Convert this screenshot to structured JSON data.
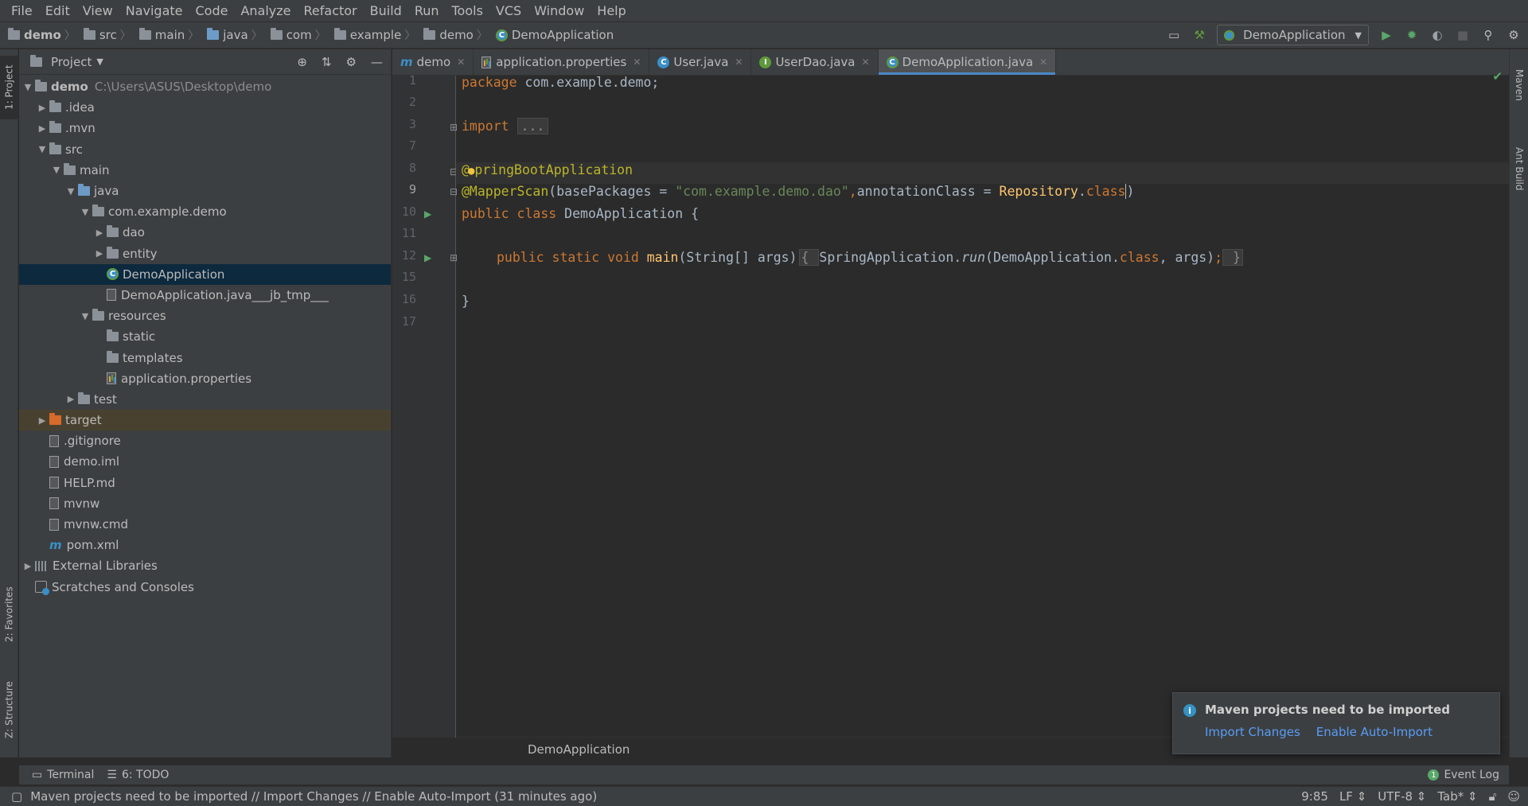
{
  "menu": [
    "File",
    "Edit",
    "View",
    "Navigate",
    "Code",
    "Analyze",
    "Refactor",
    "Build",
    "Run",
    "Tools",
    "VCS",
    "Window",
    "Help"
  ],
  "breadcrumb": [
    "demo",
    "src",
    "main",
    "java",
    "com",
    "example",
    "demo",
    "DemoApplication"
  ],
  "toolbar": {
    "run_config": "DemoApplication"
  },
  "left_strip": {
    "project": "1: Project",
    "favorites": "2: Favorites",
    "structure": "Z: Structure"
  },
  "right_strip": {
    "maven": "Maven",
    "ant": "Ant Build"
  },
  "project_panel": {
    "title": "Project",
    "tree": [
      {
        "label": "demo",
        "sub": "C:\\Users\\ASUS\\Desktop\\demo"
      },
      {
        "label": ".idea"
      },
      {
        "label": ".mvn"
      },
      {
        "label": "src"
      },
      {
        "label": "main"
      },
      {
        "label": "java"
      },
      {
        "label": "com.example.demo"
      },
      {
        "label": "dao"
      },
      {
        "label": "entity"
      },
      {
        "label": "DemoApplication"
      },
      {
        "label": "DemoApplication.java___jb_tmp___"
      },
      {
        "label": "resources"
      },
      {
        "label": "static"
      },
      {
        "label": "templates"
      },
      {
        "label": "application.properties"
      },
      {
        "label": "test"
      },
      {
        "label": "target"
      },
      {
        "label": ".gitignore"
      },
      {
        "label": "demo.iml"
      },
      {
        "label": "HELP.md"
      },
      {
        "label": "mvnw"
      },
      {
        "label": "mvnw.cmd"
      },
      {
        "label": "pom.xml"
      },
      {
        "label": "External Libraries"
      },
      {
        "label": "Scratches and Consoles"
      }
    ]
  },
  "tabs": [
    "demo",
    "application.properties",
    "User.java",
    "UserDao.java",
    "DemoApplication.java"
  ],
  "editor": {
    "line_numbers": [
      "1",
      "2",
      "3",
      "7",
      "8",
      "9",
      "10",
      "11",
      "12",
      "15",
      "16",
      "17"
    ],
    "code": {
      "l1_kw": "package ",
      "l1_rest": "com.example.demo;",
      "l3_kw": "import ",
      "l3_fold": "...",
      "l8_at": "@",
      "l8_ann": "pringBootApplication",
      "l9_ann": "@MapperScan",
      "l9_a": "(basePackages = ",
      "l9_str": "\"com.example.demo.dao\"",
      "l9_comma": ",",
      "l9_b": "annotationClass = ",
      "l9_repo": "Repository",
      "l9_dot": ".",
      "l9_class": "class",
      "l9_end": ")",
      "l10_kw": "public class ",
      "l10_rest": "DemoApplication {",
      "l12_kw": "public static void ",
      "l12_fn": "main",
      "l12_args": "(String[] args)",
      "l12_lb": "{ ",
      "l12_call": "SpringApplication.",
      "l12_run": "run",
      "l12_p": "(DemoApplication.",
      "l12_class": "class",
      "l12_end": ", args)",
      "l12_semi": ";",
      "l12_rb": " }",
      "l16": "}"
    },
    "bottom_breadcrumb": "DemoApplication"
  },
  "notification": {
    "title": "Maven projects need to be imported",
    "link1": "Import Changes",
    "link2": "Enable Auto-Import"
  },
  "bottom_tools": {
    "terminal": "Terminal",
    "todo": "6: TODO",
    "event_log": "Event Log"
  },
  "status": {
    "message": "Maven projects need to be imported // Import Changes // Enable Auto-Import (31 minutes ago)",
    "position": "9:85",
    "line_sep": "LF",
    "encoding": "UTF-8",
    "indent": "Tab*"
  }
}
